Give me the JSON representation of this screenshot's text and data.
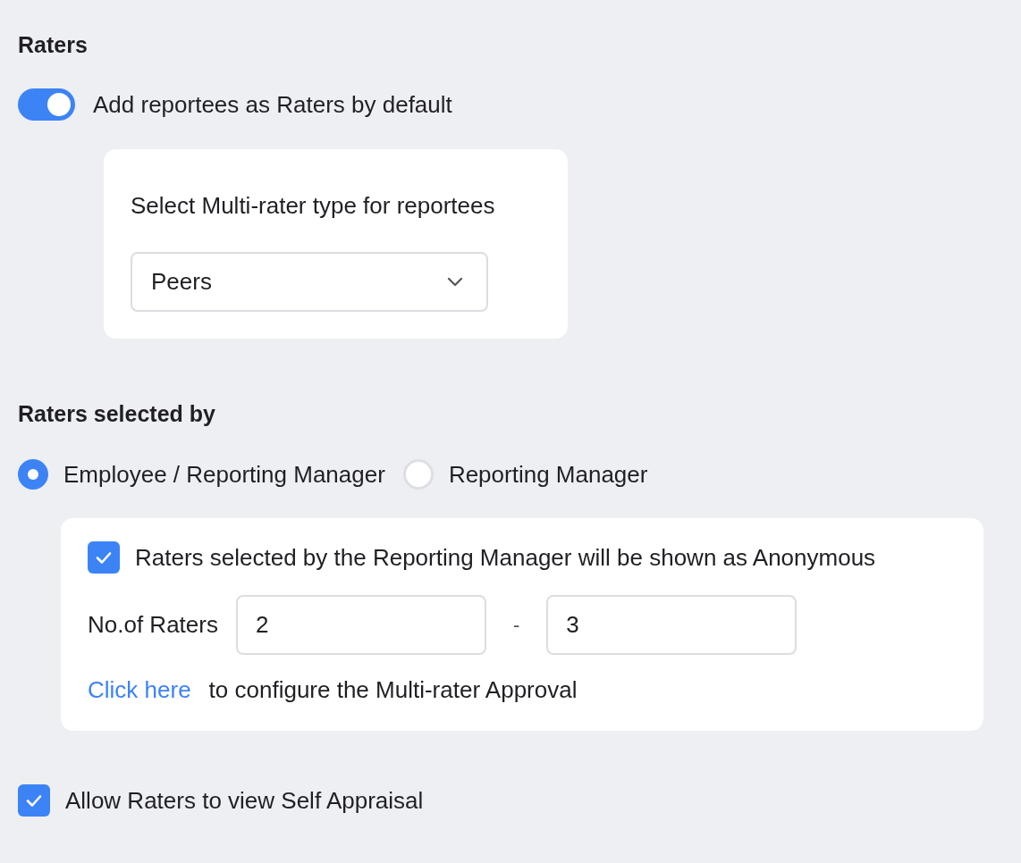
{
  "section_title": "Raters",
  "default_toggle": {
    "label": "Add reportees as Raters by default",
    "on": true
  },
  "multirater_card": {
    "label": "Select Multi-rater type for reportees",
    "dropdown": {
      "value": "Peers"
    }
  },
  "selected_by": {
    "title": "Raters selected by",
    "options": [
      {
        "label": "Employee / Reporting Manager",
        "selected": true
      },
      {
        "label": "Reporting Manager",
        "selected": false
      }
    ]
  },
  "manager_card": {
    "anonymous": {
      "label": "Raters selected by the Reporting Manager will be shown as Anonymous",
      "checked": true
    },
    "raters_count": {
      "label": "No.of Raters",
      "min": "2",
      "separator": "-",
      "max": "3"
    },
    "approval": {
      "link": "Click here",
      "text": "to configure the Multi-rater Approval"
    }
  },
  "self_appraisal": {
    "label": "Allow Raters to view Self Appraisal",
    "checked": true
  }
}
